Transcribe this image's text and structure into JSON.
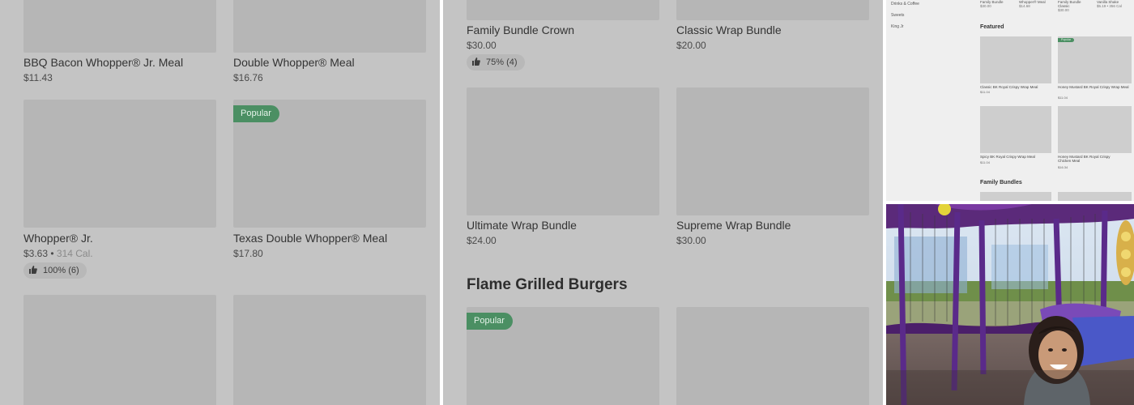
{
  "panel_a": {
    "items": [
      {
        "name": "BBQ Bacon Whopper® Jr. Meal",
        "price": "$11.43"
      },
      {
        "name": "Double Whopper® Meal",
        "price": "$16.76"
      },
      {
        "name": "Whopper® Jr.",
        "price": "$3.63",
        "calories": "314 Cal.",
        "rating": "100% (6)"
      },
      {
        "name": "Texas Double Whopper® Meal",
        "price": "$17.80",
        "badge": "Popular"
      }
    ],
    "separator": " • "
  },
  "panel_b": {
    "items": [
      {
        "name": "Family Bundle Crown",
        "price": "$30.00",
        "rating": "75% (4)"
      },
      {
        "name": "Classic Wrap Bundle",
        "price": "$20.00"
      },
      {
        "name": "Ultimate Wrap Bundle",
        "price": "$24.00"
      },
      {
        "name": "Supreme Wrap Bundle",
        "price": "$30.00"
      }
    ],
    "section_title": "Flame Grilled Burgers",
    "next_badge": "Popular"
  },
  "panel_c": {
    "nav": [
      "Drinks & Coffee",
      "Sweets",
      "King Jr"
    ],
    "top_items": [
      {
        "name": "Family Bundle",
        "price": "$30.00"
      },
      {
        "name": "Whopper® Meal",
        "price": "$14.68"
      },
      {
        "name": "Family Bundle Classic",
        "price": "$30.00"
      },
      {
        "name": "Vanilla Shake",
        "price": "$5.19",
        "calories": "356 Cal"
      }
    ],
    "featured_heading": "Featured",
    "featured_badge": "Popular",
    "featured": [
      {
        "name": "Classic BK Royal Crispy Wrap Meal",
        "price": "$11.04"
      },
      {
        "name": "Honey Mustard BK Royal Crispy Wrap Meal",
        "price": "$11.04"
      },
      {
        "name": "Spicy BK Royal Crispy Wrap Meal",
        "price": "$11.04"
      },
      {
        "name": "Honey Mustard BK Royal Crispy Chicken Meal",
        "price": "$16.34"
      }
    ],
    "bundles_heading": "Family Bundles"
  },
  "colors": {
    "overlay": "#c4c4c4",
    "placeholder": "#b6b6b6",
    "badge_green": "#4b8f63"
  },
  "icons": {
    "rating": "thumbs-up-icon"
  }
}
